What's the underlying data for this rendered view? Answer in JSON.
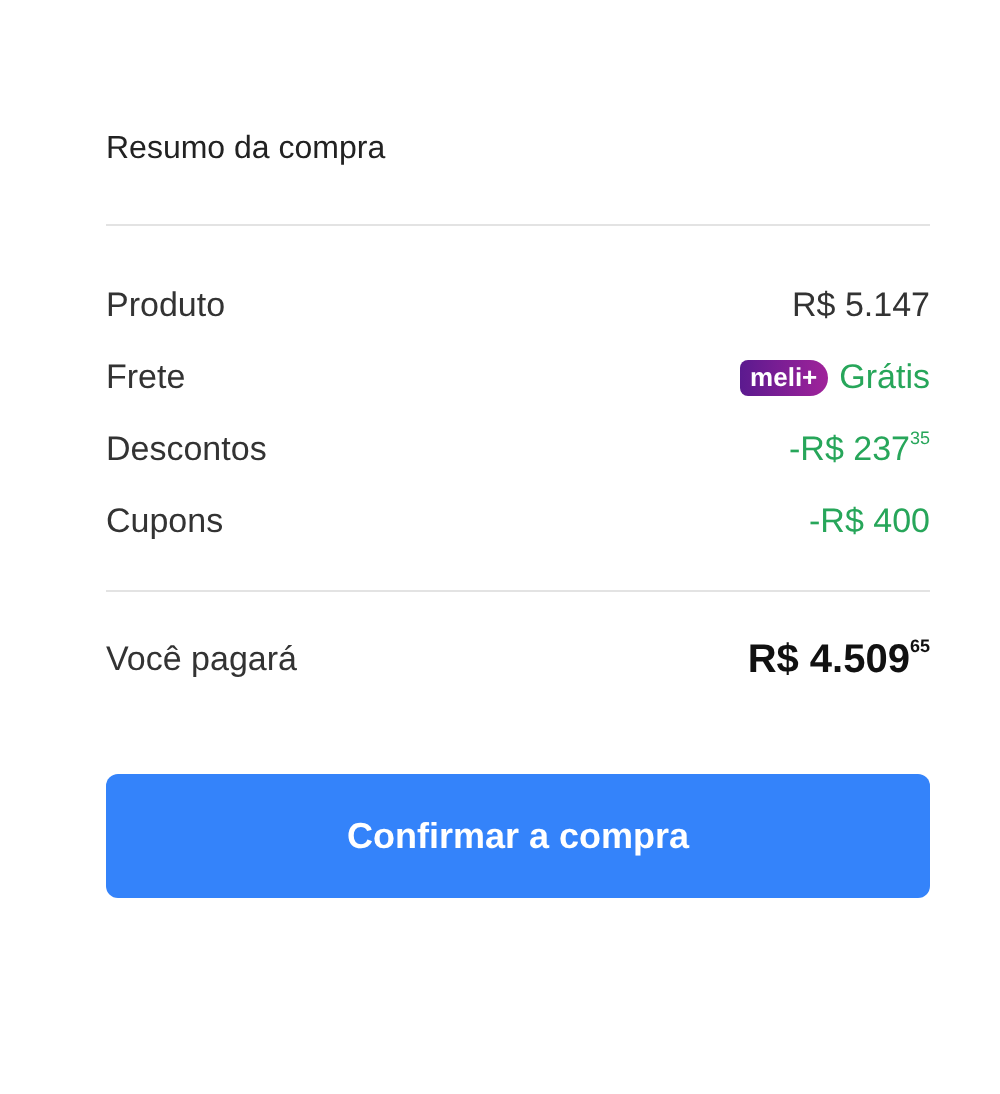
{
  "summary": {
    "title": "Resumo da compra",
    "rows": [
      {
        "label": "Produto",
        "value": "R$ 5.147",
        "kind": "plain"
      },
      {
        "label": "Frete",
        "badge": "meli+",
        "value": "Grátis",
        "kind": "positive"
      },
      {
        "label": "Descontos",
        "value": "-R$ 237$^{35}$",
        "kind": "positive"
      },
      {
        "label": "Cupons",
        "value": "-R$ 400",
        "kind": "positive"
      }
    ],
    "total": {
      "label": "Você pagará",
      "value": "R$ 4.509$^{65}$"
    },
    "button": "Confirmar a compra"
  }
}
